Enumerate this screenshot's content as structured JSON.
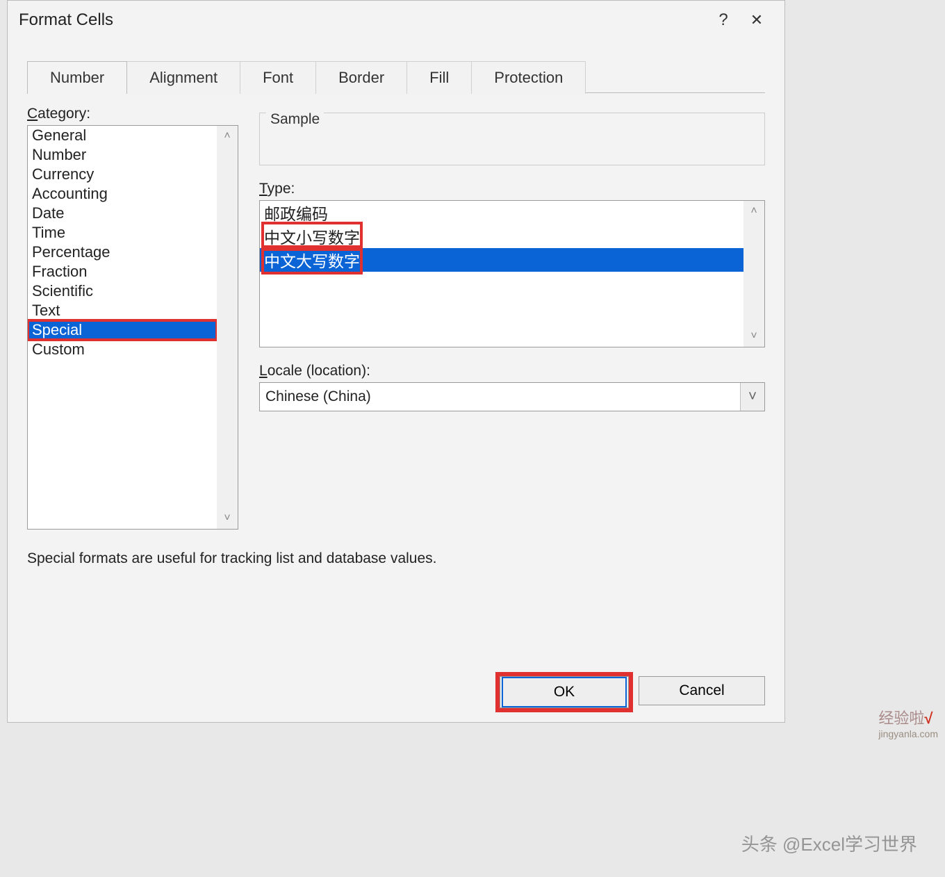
{
  "dialog": {
    "title": "Format Cells",
    "help_glyph": "?",
    "close_glyph": "✕"
  },
  "tabs": [
    "Number",
    "Alignment",
    "Font",
    "Border",
    "Fill",
    "Protection"
  ],
  "active_tab": "Number",
  "category": {
    "label": "Category:",
    "items": [
      "General",
      "Number",
      "Currency",
      "Accounting",
      "Date",
      "Time",
      "Percentage",
      "Fraction",
      "Scientific",
      "Text",
      "Special",
      "Custom"
    ],
    "selected": "Special"
  },
  "sample": {
    "label": "Sample",
    "value": ""
  },
  "type": {
    "label": "Type:",
    "items": [
      "邮政编码",
      "中文小写数字",
      "中文大写数字"
    ],
    "selected": "中文大写数字"
  },
  "locale": {
    "label": "Locale (location):",
    "value": "Chinese (China)"
  },
  "description": "Special formats are useful for tracking list and database values.",
  "buttons": {
    "ok": "OK",
    "cancel": "Cancel"
  },
  "watermark": "头条 @Excel学习世界",
  "watermark2": {
    "text": "经验啦",
    "sub": "jingyanla.com"
  }
}
